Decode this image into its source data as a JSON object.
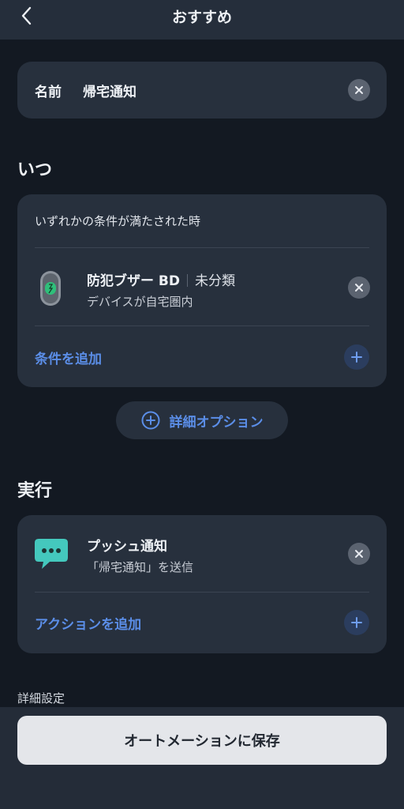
{
  "nav": {
    "title": "おすすめ",
    "back_icon": "chevron-left-icon"
  },
  "name_field": {
    "label": "名前",
    "value": "帰宅通知"
  },
  "when": {
    "title": "いつ",
    "condition_desc": "いずれかの条件が満たされた時",
    "device": {
      "name": "防犯ブザー BD",
      "category": "未分類",
      "status": "デバイスが自宅圏内"
    },
    "add_label": "条件を追加"
  },
  "advanced_option": {
    "label": "詳細オプション"
  },
  "execute": {
    "title": "実行",
    "action": {
      "name": "プッシュ通知",
      "desc": "「帰宅通知」を送信"
    },
    "add_label": "アクションを追加"
  },
  "detail_settings_label": "詳細設定",
  "save_button": {
    "label": "オートメーションに保存"
  },
  "colors": {
    "background": "#131922",
    "card": "#27303d",
    "accent": "#5b8ee8",
    "chat_icon": "#44c8bd",
    "device_green": "#2fbf7a"
  }
}
